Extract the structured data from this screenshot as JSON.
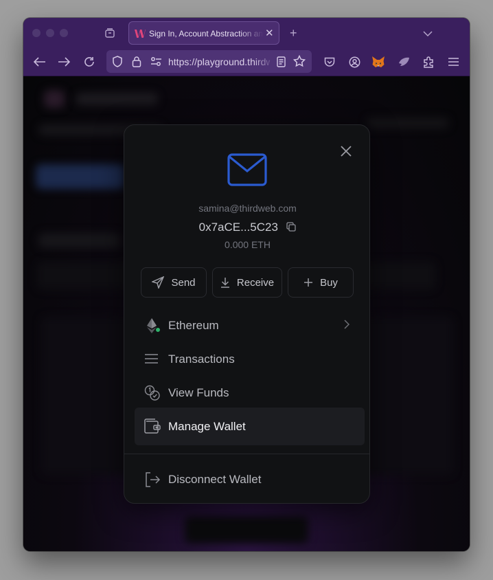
{
  "browser": {
    "tab_title": "Sign In, Account Abstraction and",
    "url": "https://playground.thirdweb.com"
  },
  "modal": {
    "email": "samina@thirdweb.com",
    "address": "0x7aCE...5C23",
    "balance": "0.000 ETH",
    "actions": {
      "send": "Send",
      "receive": "Receive",
      "buy": "Buy"
    },
    "menu": {
      "network": "Ethereum",
      "transactions": "Transactions",
      "view_funds": "View Funds",
      "manage_wallet": "Manage Wallet",
      "disconnect": "Disconnect Wallet"
    }
  },
  "colors": {
    "browser_chrome": "#3a1f5e",
    "modal_bg": "#111214",
    "accent_blue": "#2b5bd0",
    "network_status": "#2fb36b"
  }
}
